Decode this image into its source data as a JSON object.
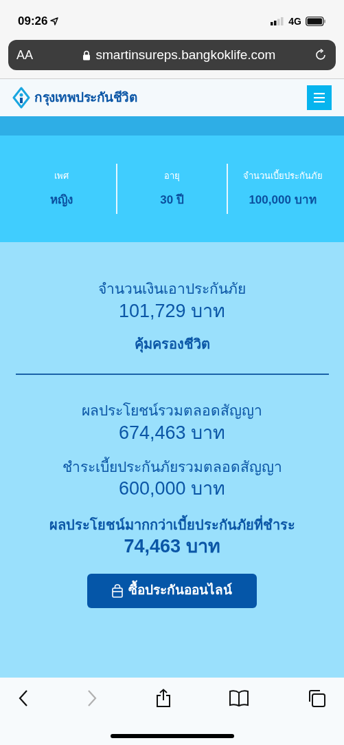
{
  "status_bar": {
    "time": "09:26",
    "network": "4G"
  },
  "address_bar": {
    "text_size_button": "AA",
    "url": "smartinsureps.bangkoklife.com"
  },
  "header": {
    "brand": "กรุงเทพประกันชีวิต"
  },
  "summary": [
    {
      "label": "เพศ",
      "value": "หญิง"
    },
    {
      "label": "อายุ",
      "value": "30 ปี"
    },
    {
      "label": "จำนวนเบี้ยประกันภัย",
      "value": "100,000 บาท"
    }
  ],
  "sum_insured": {
    "label": "จำนวนเงินเอาประกันภัย",
    "value": "101,729 บาท"
  },
  "coverage": "คุ้มครองชีวิต",
  "totals": [
    {
      "label": "ผลประโยชน์รวมตลอดสัญญา",
      "value": "674,463 บาท"
    },
    {
      "label": "ชำระเบี้ยประกันภัยรวมตลอดสัญญา",
      "value": "600,000 บาท"
    }
  ],
  "surplus": {
    "label": "ผลประโยชน์มากกว่าเบี้ยประกันภัยที่ชำระ",
    "value": "74,463 บาท"
  },
  "buy_button": "ซื้อประกันออนไลน์",
  "browser_toolbar": {
    "back_disabled": false,
    "forward_disabled": true
  }
}
